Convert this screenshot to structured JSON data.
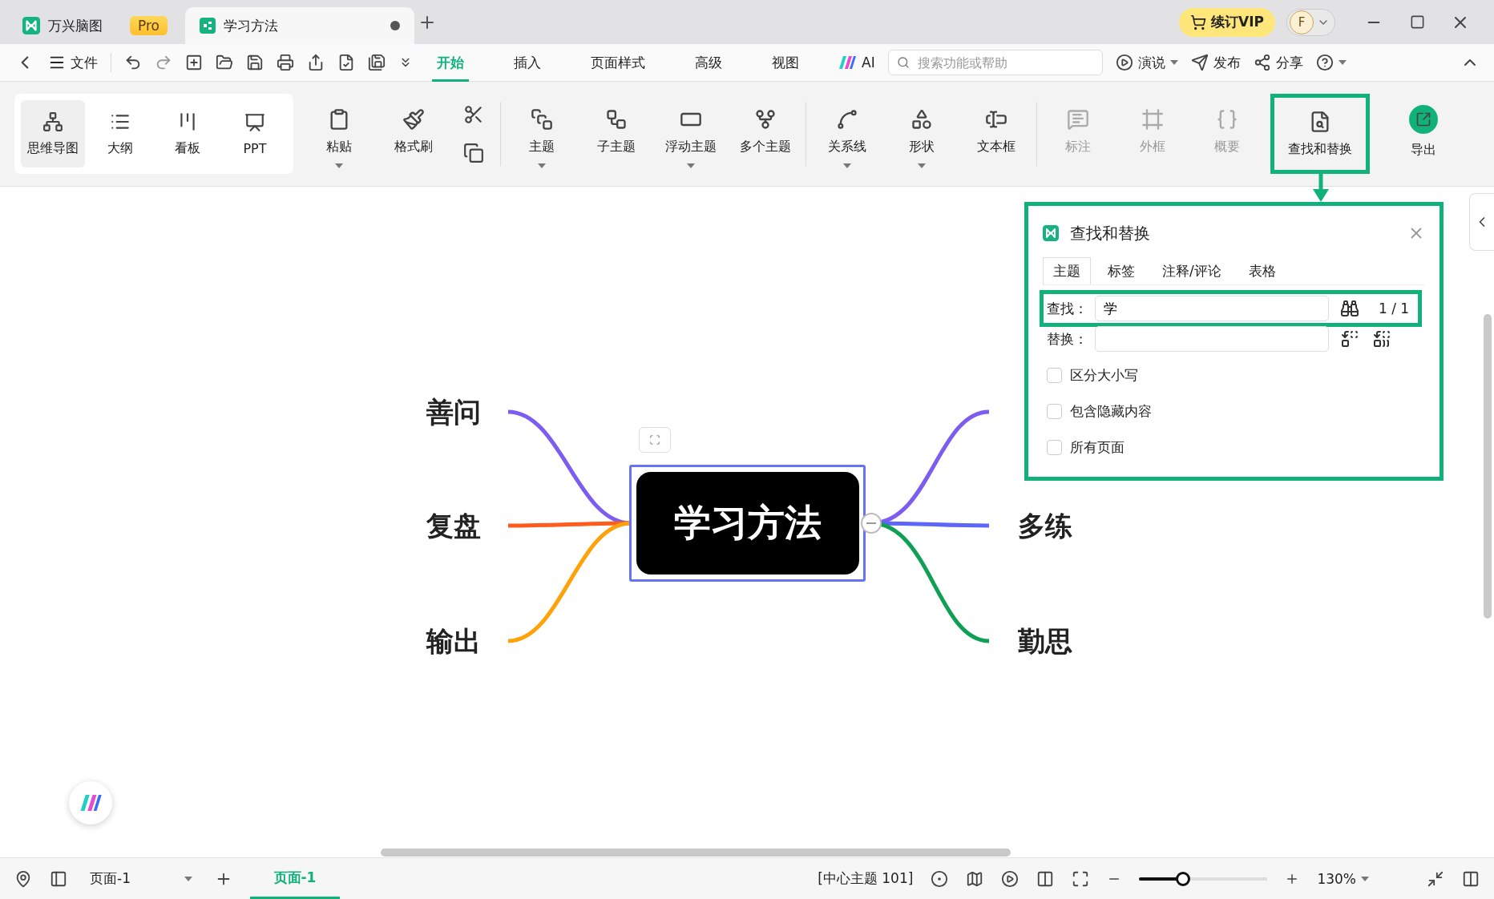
{
  "tabs": [
    {
      "kind": "app",
      "title": "万兴脑图",
      "badge": "Pro",
      "selected": false
    },
    {
      "kind": "document",
      "title": "学习方法",
      "selected": true,
      "unsaved": true
    }
  ],
  "vip_button": "续订VIP",
  "avatar": "F",
  "menu": {
    "file": "文件",
    "tabs": [
      {
        "label": "开始",
        "selected": true
      },
      {
        "label": "插入",
        "selected": false
      },
      {
        "label": "页面样式",
        "selected": false
      },
      {
        "label": "高级",
        "selected": false
      },
      {
        "label": "视图",
        "selected": false
      }
    ],
    "ai": "AI",
    "search": {
      "placeholder": "搜索功能或帮助"
    },
    "actions": [
      {
        "label": "演说",
        "dropdown": true
      },
      {
        "label": "发布",
        "dropdown": false
      },
      {
        "label": "分享",
        "dropdown": false
      }
    ]
  },
  "ribbon": {
    "views": [
      {
        "label": "思维导图",
        "selected": true
      },
      {
        "label": "大纲",
        "selected": false
      },
      {
        "label": "看板",
        "selected": false
      },
      {
        "label": "PPT",
        "selected": false
      }
    ],
    "groups": [
      {
        "items": [
          {
            "kind": "button",
            "label": "粘贴",
            "dropdown": true,
            "disabled": false,
            "highlighted": false
          },
          {
            "kind": "button",
            "label": "格式刷",
            "dropdown": false,
            "disabled": false,
            "highlighted": false
          },
          {
            "kind": "pair"
          }
        ]
      },
      {
        "items": [
          {
            "kind": "button",
            "label": "主题",
            "dropdown": true,
            "disabled": false,
            "highlighted": false
          },
          {
            "kind": "button",
            "label": "子主题",
            "dropdown": false,
            "disabled": false,
            "highlighted": false
          },
          {
            "kind": "button",
            "label": "浮动主题",
            "dropdown": true,
            "disabled": false,
            "highlighted": false
          },
          {
            "kind": "button",
            "label": "多个主题",
            "dropdown": false,
            "disabled": false,
            "highlighted": false
          }
        ]
      },
      {
        "items": [
          {
            "kind": "button",
            "label": "关系线",
            "dropdown": true,
            "disabled": false,
            "highlighted": false
          },
          {
            "kind": "button",
            "label": "形状",
            "dropdown": true,
            "disabled": false,
            "highlighted": false
          },
          {
            "kind": "button",
            "label": "文本框",
            "dropdown": false,
            "disabled": false,
            "highlighted": false
          }
        ]
      },
      {
        "items": [
          {
            "kind": "button",
            "label": "标注",
            "dropdown": false,
            "disabled": true,
            "highlighted": false
          },
          {
            "kind": "button",
            "label": "外框",
            "dropdown": false,
            "disabled": true,
            "highlighted": false
          },
          {
            "kind": "button",
            "label": "概要",
            "dropdown": false,
            "disabled": true,
            "highlighted": false
          },
          {
            "kind": "button",
            "label": "查找和替换",
            "dropdown": false,
            "disabled": false,
            "highlighted": true
          },
          {
            "kind": "accent",
            "label": "导出",
            "dropdown": false,
            "disabled": false,
            "highlighted": false
          }
        ]
      }
    ]
  },
  "mindmap": {
    "center": "学习方法",
    "selected": true,
    "left": [
      {
        "label": "善问",
        "color": "#7d5cf0"
      },
      {
        "label": "复盘",
        "color": "#ff5b1c"
      },
      {
        "label": "输出",
        "color": "#ffa20a"
      }
    ],
    "right": [
      {
        "color": "#7d5cf0"
      },
      {
        "label": "多练",
        "color": "#5d66f6"
      },
      {
        "label": "勤思",
        "color": "#10a055"
      }
    ]
  },
  "dialog": {
    "title": "查找和替换",
    "highlighted": true,
    "tabs": [
      {
        "label": "主题",
        "selected": true
      },
      {
        "label": "标签",
        "selected": false
      },
      {
        "label": "注释/评论",
        "selected": false
      },
      {
        "label": "表格",
        "selected": false
      }
    ],
    "find": {
      "label": "查找：",
      "value": "学",
      "count": "1 / 1",
      "highlighted": true
    },
    "replace": {
      "label": "替换："
    },
    "options": [
      {
        "label": "区分大小写",
        "checked": false
      },
      {
        "label": "包含隐藏内容",
        "checked": false
      },
      {
        "label": "所有页面",
        "checked": false
      }
    ]
  },
  "status": {
    "page_select": "页面-1",
    "page_tabs": [
      {
        "label": "页面-1",
        "selected": true
      }
    ],
    "selection": "[中心主题 101]",
    "zoom": {
      "level": 0.34,
      "reading": "130%"
    }
  }
}
